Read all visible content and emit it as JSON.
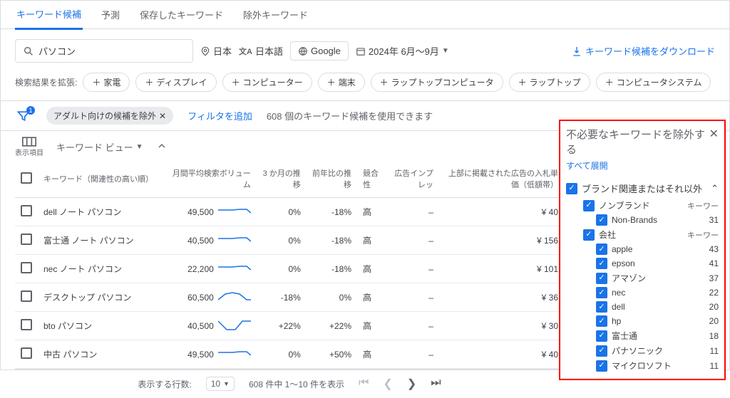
{
  "tabs": {
    "items": [
      "キーワード候補",
      "予測",
      "保存したキーワード",
      "除外キーワード"
    ],
    "active": 0
  },
  "search": {
    "query": "パソコン"
  },
  "targeting": {
    "location": "日本",
    "language": "日本語",
    "network": "Google",
    "daterange": "2024年 6月～9月"
  },
  "download_label": "キーワード候補をダウンロード",
  "expand": {
    "label": "検索結果を拡張:",
    "items": [
      "家電",
      "ディスプレイ",
      "コンピューター",
      "端末",
      "ラップトップコンピュータ",
      "ラップトップ",
      "コンピュータシステム"
    ]
  },
  "filter": {
    "applied": "アダルト向けの候補を除外",
    "add_label": "フィルタを追加",
    "info": "608 個のキーワード候補を使用できます"
  },
  "view": {
    "columns_label": "表示項目",
    "view_label": "キーワード ビュー"
  },
  "table": {
    "headers": {
      "kw": "キーワード（関連性の高い順）",
      "vol": "月間平均検索ボリューム",
      "m3": "3 か月の推移",
      "yoy": "前年比の推移",
      "comp": "競合性",
      "impr": "広告インプレッ",
      "bid": "上部に掲載された広告の入札単価（低額帯）"
    },
    "rows": [
      {
        "kw": "dell ノート パソコン",
        "vol": "49,500",
        "m3": "0%",
        "yoy": "-18%",
        "comp": "高",
        "impr": "–",
        "bid": "¥ 40",
        "spark": "flat"
      },
      {
        "kw": "富士通 ノート パソコン",
        "vol": "40,500",
        "m3": "0%",
        "yoy": "-18%",
        "comp": "高",
        "impr": "–",
        "bid": "¥ 156",
        "spark": "flat"
      },
      {
        "kw": "nec ノート パソコン",
        "vol": "22,200",
        "m3": "0%",
        "yoy": "-18%",
        "comp": "高",
        "impr": "–",
        "bid": "¥ 101",
        "spark": "flat"
      },
      {
        "kw": "デスクトップ パソコン",
        "vol": "60,500",
        "m3": "-18%",
        "yoy": "0%",
        "comp": "高",
        "impr": "–",
        "bid": "¥ 36",
        "spark": "hump"
      },
      {
        "kw": "bto パソコン",
        "vol": "40,500",
        "m3": "+22%",
        "yoy": "+22%",
        "comp": "高",
        "impr": "–",
        "bid": "¥ 30",
        "spark": "dip"
      },
      {
        "kw": "中古 パソコン",
        "vol": "49,500",
        "m3": "0%",
        "yoy": "+50%",
        "comp": "高",
        "impr": "–",
        "bid": "¥ 40",
        "spark": "flat"
      }
    ]
  },
  "pager": {
    "rows_label": "表示する行数:",
    "rows_value": "10",
    "info": "608 件中 1～10 件を表示"
  },
  "panel": {
    "title": "不必要なキーワードを除外する",
    "expand_all": "すべて展開",
    "group_main": "ブランド関連またはそれ以外",
    "nonbrand": {
      "label": "ノンブランド",
      "metric": "キーワー",
      "sub": {
        "label": "Non-Brands",
        "value": "31"
      }
    },
    "company": {
      "label": "会社",
      "metric": "キーワー",
      "items": [
        {
          "label": "apple",
          "value": "43"
        },
        {
          "label": "epson",
          "value": "41"
        },
        {
          "label": "アマゾン",
          "value": "37"
        },
        {
          "label": "nec",
          "value": "22"
        },
        {
          "label": "dell",
          "value": "20"
        },
        {
          "label": "hp",
          "value": "20"
        },
        {
          "label": "富士通",
          "value": "18"
        },
        {
          "label": "パナソニック",
          "value": "11"
        },
        {
          "label": "マイクロソフト",
          "value": "11"
        }
      ]
    }
  }
}
